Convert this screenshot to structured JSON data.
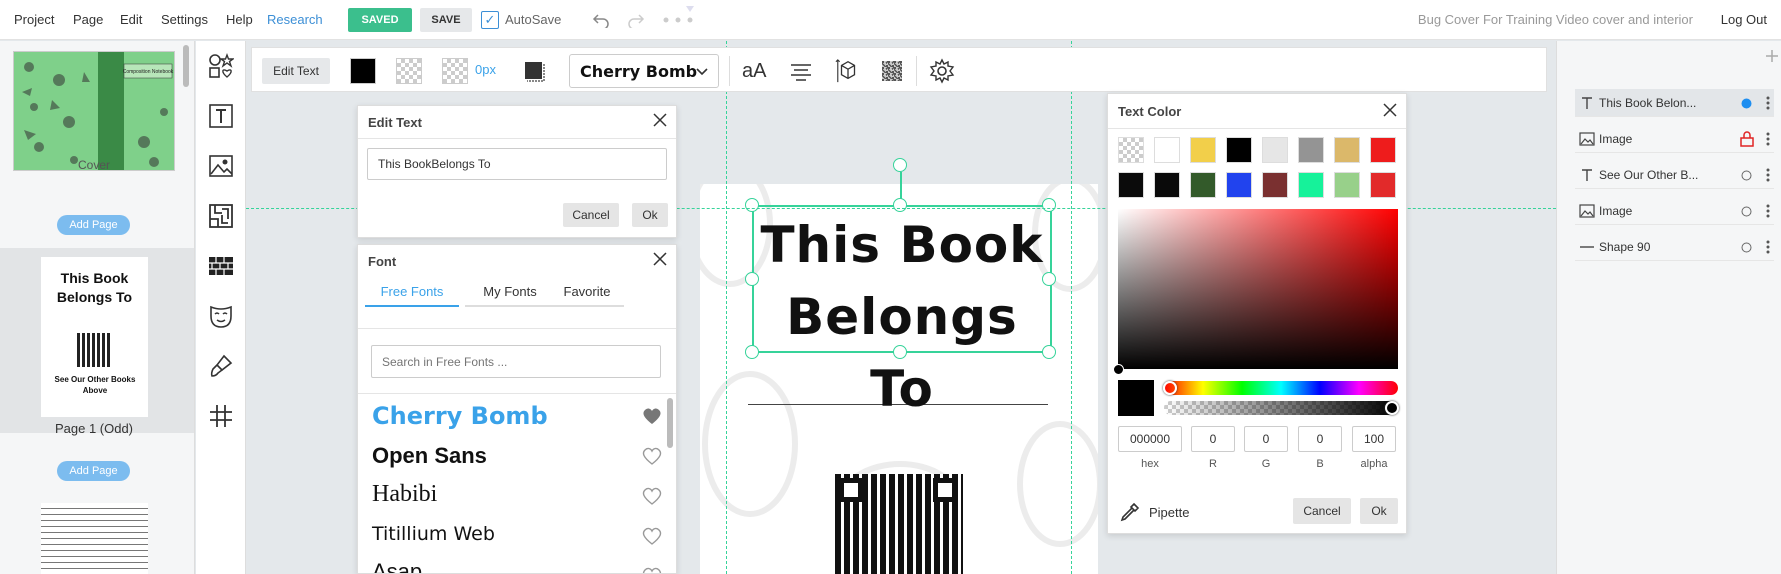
{
  "menu": {
    "items": [
      "Project",
      "Page",
      "Edit",
      "Settings",
      "Help"
    ],
    "research": "Research",
    "saved_badge": "SAVED",
    "save_button": "SAVE",
    "autosave_label": "AutoSave",
    "doc_title": "Bug Cover For Training Video cover and interior",
    "logout": "Log Out"
  },
  "pages": {
    "cover_label": "Cover",
    "cover_book_title": "Composition Notebook",
    "add_page": "Add Page",
    "page1_label": "Page 1 (Odd)",
    "page1_title": "This Book Belongs To",
    "page1_sub": "See Our Other Books Above"
  },
  "toolbar": {
    "edit_text": "Edit Text",
    "stroke_width": "0px",
    "font_name": "Cherry Bomb",
    "text_size_glyph": "aA"
  },
  "canvas": {
    "heading_line1": "This Book",
    "heading_line2": "Belongs To"
  },
  "edit_text_panel": {
    "title": "Edit Text",
    "value": "This BookBelongs To",
    "cancel": "Cancel",
    "ok": "Ok"
  },
  "font_panel": {
    "title": "Font",
    "tabs": [
      "Free Fonts",
      "My Fonts",
      "Favorite"
    ],
    "search_placeholder": "Search in Free Fonts ...",
    "fonts": [
      {
        "name": "Cherry Bomb",
        "favorite": true
      },
      {
        "name": "Open Sans",
        "favorite": false
      },
      {
        "name": "Habibi",
        "favorite": false
      },
      {
        "name": "Titillium Web",
        "favorite": false
      },
      {
        "name": "Asap",
        "favorite": false
      }
    ]
  },
  "color_panel": {
    "title": "Text Color",
    "swatches_row1": [
      "transparent",
      "#ffffff",
      "#f2cf4a",
      "#000000",
      "#e6e6e6",
      "#949494",
      "#dbb86a",
      "#ee1c1c"
    ],
    "swatches_row2": [
      "#0b0b0b",
      "#0a0a0a",
      "#335a2a",
      "#2143ee",
      "#7a3030",
      "#16f29a",
      "#98d08a",
      "#e22a2a"
    ],
    "hex": "000000",
    "r": "0",
    "g": "0",
    "b": "0",
    "alpha": "100",
    "labels": {
      "hex": "hex",
      "r": "R",
      "g": "G",
      "b": "B",
      "alpha": "alpha"
    },
    "pipette": "Pipette",
    "cancel": "Cancel",
    "ok": "Ok"
  },
  "layers": [
    {
      "name": "This Book Belon...",
      "icon": "text-icon",
      "status": "selected"
    },
    {
      "name": "Image",
      "icon": "image-icon",
      "status": "locked"
    },
    {
      "name": "See Our Other B...",
      "icon": "text-icon",
      "status": "none"
    },
    {
      "name": "Image",
      "icon": "image-icon",
      "status": "none"
    },
    {
      "name": "Shape 90",
      "icon": "line-icon",
      "status": "none"
    }
  ],
  "colors": {
    "accent": "#3c8fd6",
    "saved_green": "#3bbf8d",
    "guide": "#36d39a",
    "selected_font": "#3aa2e9"
  }
}
